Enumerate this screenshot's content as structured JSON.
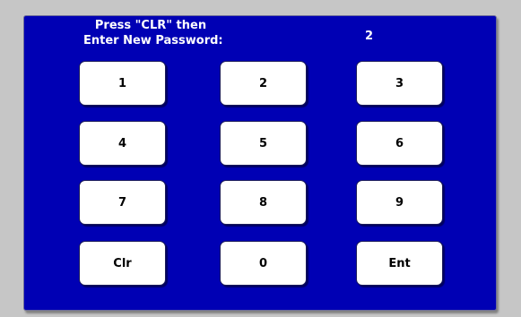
{
  "prompt": {
    "line1": "Press \"CLR\" then",
    "line2": "Enter New Password:"
  },
  "entry_display": "2",
  "keypad": {
    "k1": "1",
    "k2": "2",
    "k3": "3",
    "k4": "4",
    "k5": "5",
    "k6": "6",
    "k7": "7",
    "k8": "8",
    "k9": "9",
    "clr": "Clr",
    "k0": "0",
    "ent": "Ent"
  },
  "colors": {
    "panel": "#0000b4",
    "key_face": "#ffffff",
    "frame": "#c6c6c6"
  }
}
